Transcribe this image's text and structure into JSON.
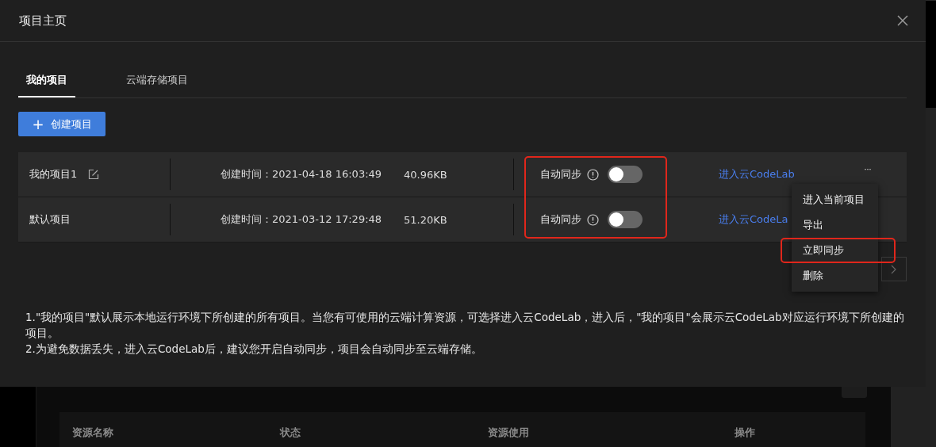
{
  "background": {
    "table": {
      "columns": [
        "资源名称",
        "状态",
        "资源使用",
        "操作"
      ]
    }
  },
  "dialog": {
    "title": "项目主页",
    "tabs": [
      {
        "label": "我的项目",
        "selected": true
      },
      {
        "label": "云端存储项目",
        "selected": false
      }
    ],
    "create_button": {
      "icon": "+",
      "label": "创建项目"
    },
    "projects": {
      "sync_highlighted": true,
      "rows": [
        {
          "name": "我的项目1",
          "editable": true,
          "created": "创建时间：2021-04-18 16:03:49",
          "size": "40.96KB",
          "sync_label": "自动同步",
          "sync_on": false,
          "link": "进入云CodeLab",
          "more": "···"
        },
        {
          "name": "默认项目",
          "editable": false,
          "created": "创建时间：2021-03-12 17:29:48",
          "size": "51.20KB",
          "sync_label": "自动同步",
          "sync_on": false,
          "link": "进入云CodeLa"
        }
      ]
    },
    "menu": [
      {
        "label": "进入当前项目",
        "highlighted": false
      },
      {
        "label": "导出",
        "highlighted": false
      },
      {
        "label": "立即同步",
        "highlighted": true
      },
      {
        "label": "删除",
        "highlighted": false
      }
    ],
    "notes": [
      "1.\"我的项目\"默认展示本地运行环境下所创建的所有项目。当您有可使用的云端计算资源，可选择进入云CodeLab，进入后，\"我的项目\"会展示云CodeLab对应运行环境下所创建的项目。",
      "2.为避免数据丢失，进入云CodeLab后，建议您开启自动同步，项目会自动同步至云端存储。"
    ]
  }
}
